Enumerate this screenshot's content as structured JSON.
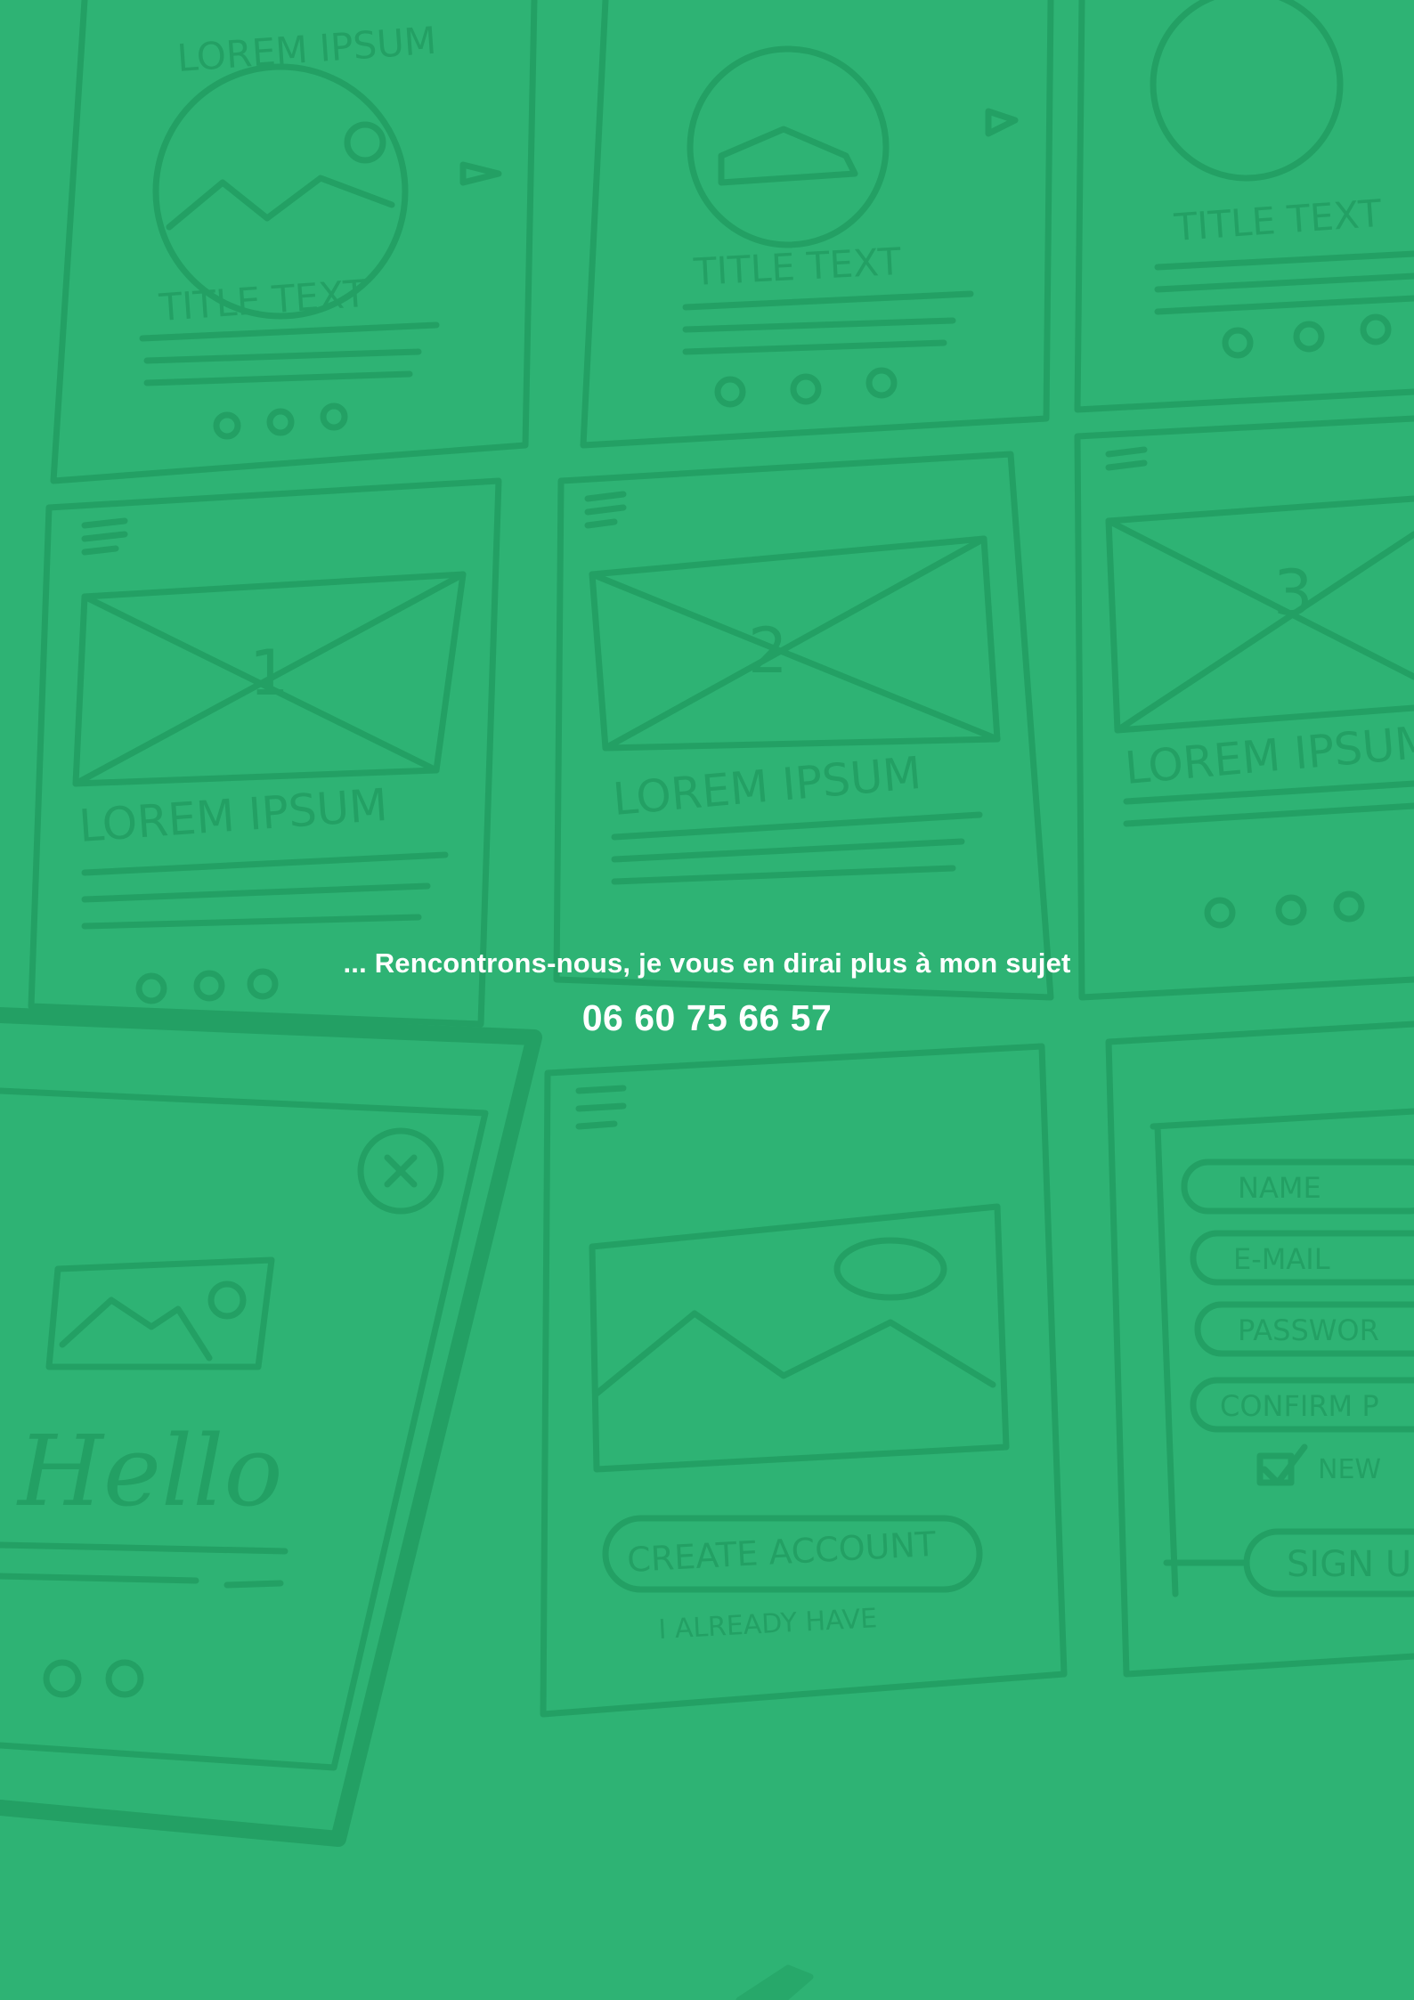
{
  "page": {
    "background_color": "#2eb374",
    "sketch_color": "#219a5f"
  },
  "background_image": {
    "subject": "hand-drawn wireframe sketches of mobile screens and a smartphone",
    "sketch_texts": [
      "LOREM IPSUM",
      "TITLE TEXT",
      "TITLE TEXT",
      "TITLE TEXT",
      "1",
      "2",
      "3",
      "LOREM IPSUM",
      "LOREM IPSUM",
      "LOREM IPSUM",
      "Hello",
      "CREATE ACCOUNT",
      "I ALREADY HAVE",
      "NAME",
      "E-MAIL",
      "PASSWOR",
      "CONFIRM P",
      "NEW",
      "SIGN U"
    ]
  },
  "contact": {
    "tagline": "... Rencontrons-nous, je vous en dirai plus à mon sujet",
    "phone": "06 60 75 66 57"
  }
}
